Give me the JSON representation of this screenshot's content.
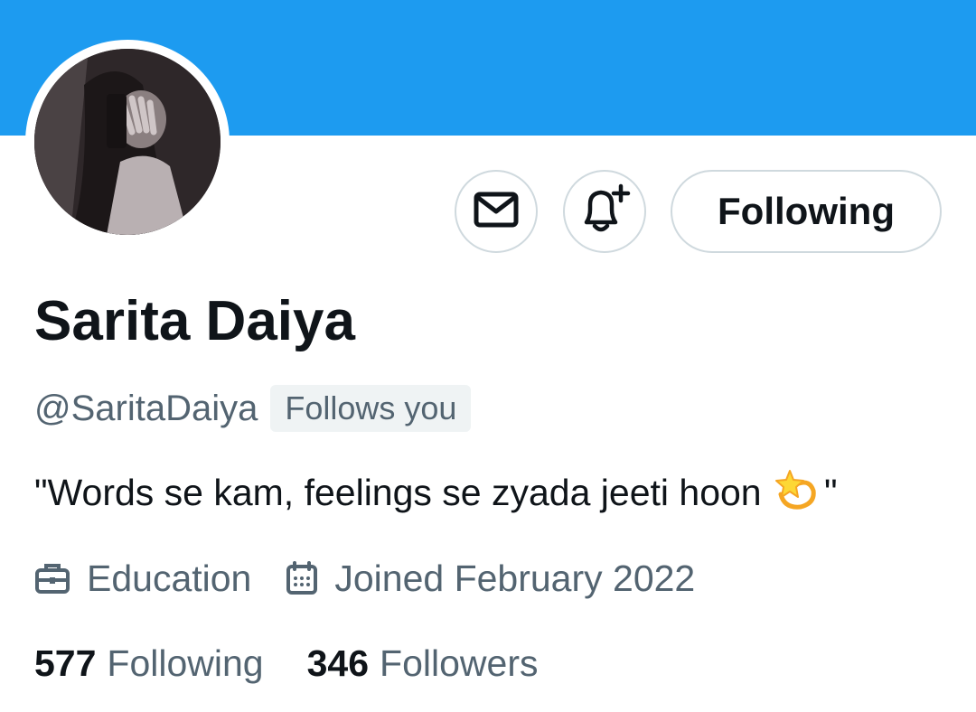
{
  "profile": {
    "display_name": "Sarita Daiya",
    "handle": "@SaritaDaiya",
    "follows_you_badge": "Follows you",
    "bio_text": "\"Words se kam, feelings se zyada jeeti hoon",
    "bio_emoji": "dizzy-star-emoji",
    "bio_closing": "\"",
    "category": "Education",
    "joined": "Joined February 2022"
  },
  "actions": {
    "message_icon": "envelope-icon",
    "notify_icon": "bell-plus-icon",
    "follow_label": "Following"
  },
  "stats": {
    "following_count": "577",
    "following_label": "Following",
    "followers_count": "346",
    "followers_label": "Followers"
  },
  "colors": {
    "banner": "#1d9bf0",
    "secondary_text": "#536471",
    "primary_text": "#0f1419",
    "border": "#cfd9de"
  }
}
